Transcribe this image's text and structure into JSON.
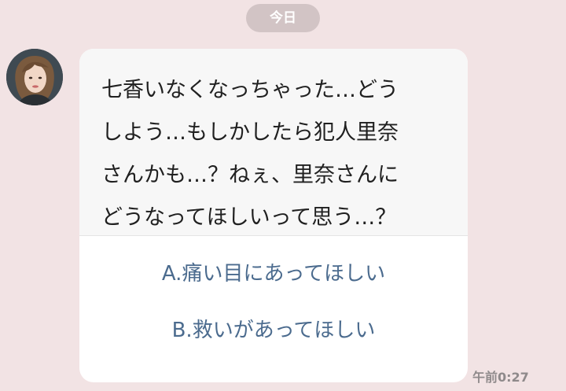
{
  "chat": {
    "date_label": "今日",
    "message": {
      "lines": [
        "七香いなくなっちゃった…どう",
        "しよう…もしかしたら犯人里奈",
        "さんかも…？ねぇ、里奈さんに",
        "どうなってほしいって思う…？"
      ],
      "options": [
        "A.痛い目にあってほしい",
        "B.救いがあってほしい"
      ],
      "time": "午前0:27"
    },
    "avatar_icon": "profile-photo",
    "colors": {
      "background": "#f2e3e4",
      "option_text": "#4b6b8e",
      "date_pill": "#d2c4c5"
    }
  }
}
